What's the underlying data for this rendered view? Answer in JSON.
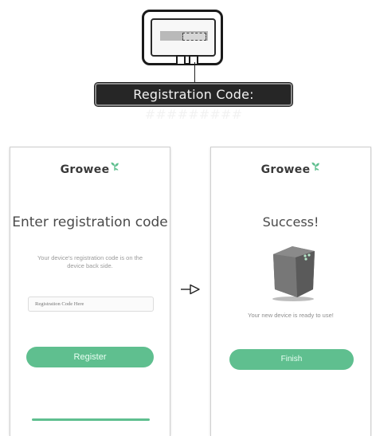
{
  "device_label": {
    "code_text": "Registration Code: #########"
  },
  "left_screen": {
    "brand": "Growee",
    "title": "Enter registration code",
    "subtitle": "Your device's registration code is on the device back side.",
    "input_placeholder": "Registration Code Here",
    "button_label": "Register"
  },
  "right_screen": {
    "brand": "Growee",
    "title": "Success!",
    "caption": "Your new device is ready to use!",
    "button_label": "Finish"
  },
  "icons": {
    "logo": "leaf-icon",
    "arrow": "arrow-right-icon",
    "device": "growee-device-icon"
  },
  "colors": {
    "accent_green": "#5fbf8f",
    "text_dark": "#4a4a4a",
    "text_muted": "#9a9a9a"
  }
}
